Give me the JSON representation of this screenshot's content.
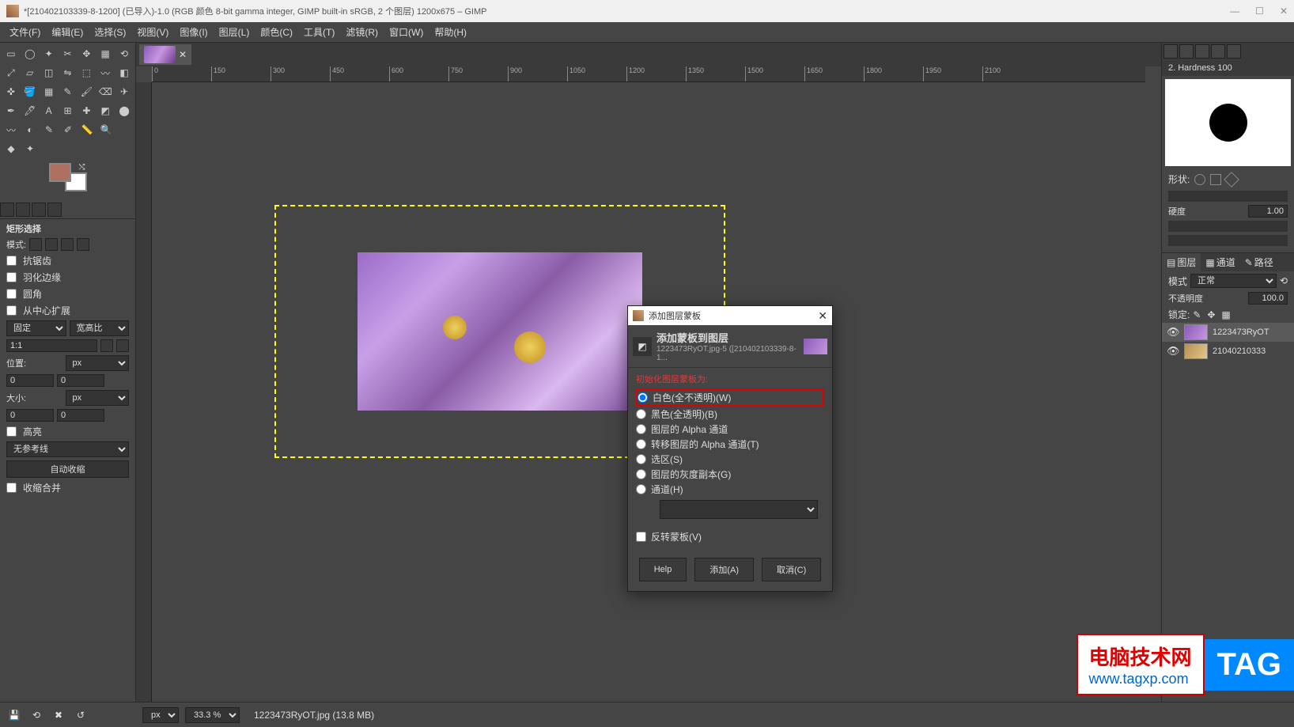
{
  "title": "*[210402103339-8-1200] (已导入)-1.0 (RGB 颜色 8-bit gamma integer, GIMP built-in sRGB, 2 个图层) 1200x675 – GIMP",
  "menu": [
    "文件(F)",
    "编辑(E)",
    "选择(S)",
    "视图(V)",
    "图像(I)",
    "图层(L)",
    "颜色(C)",
    "工具(T)",
    "滤镜(R)",
    "窗口(W)",
    "帮助(H)"
  ],
  "ruler_ticks": [
    "0",
    "150",
    "300",
    "450",
    "600",
    "750",
    "900",
    "1050",
    "1200",
    "1350",
    "1500",
    "1650",
    "1800",
    "1950",
    "2100"
  ],
  "tool_options": {
    "title": "矩形选择",
    "mode_label": "模式:",
    "antialias": "抗锯齿",
    "feather": "羽化边缘",
    "rounded": "圆角",
    "expand": "从中心扩展",
    "fixed": "固定",
    "aspect": "宽高比",
    "ratio": "1:1",
    "position": "位置:",
    "unit_px": "px",
    "pos_x": "0",
    "pos_y": "0",
    "size_label": "大小:",
    "size_w": "0",
    "size_h": "0",
    "highlight": "高亮",
    "guides": "无参考线",
    "autoshrink": "自动收缩",
    "shrinkmerged": "收缩合并"
  },
  "dialog": {
    "window_title": "添加图层蒙板",
    "header_title": "添加蒙板到图层",
    "header_sub": "1223473RyOT.jpg-5 ([210402103339-8-1...",
    "section": "初始化图层蒙板为:",
    "opts": [
      "白色(全不透明)(W)",
      "黑色(全透明)(B)",
      "图层的 Alpha 通道",
      "转移图层的 Alpha 通道(T)",
      "选区(S)",
      "图层的灰度副本(G)",
      "通道(H)"
    ],
    "invert": "反转蒙板(V)",
    "help": "Help",
    "add": "添加(A)",
    "cancel": "取消(C)"
  },
  "brush": {
    "name": "2. Hardness 100",
    "shape_label": "形状:",
    "hardness_label": "硬度",
    "hardness_val": "1.00"
  },
  "layers": {
    "tab_layers": "图层",
    "tab_channels": "通道",
    "tab_paths": "路径",
    "mode_label": "模式",
    "mode_val": "正常",
    "opacity_label": "不透明度",
    "opacity_val": "100.0",
    "lock_label": "锁定:",
    "items": [
      {
        "name": "1223473RyOT"
      },
      {
        "name": "21040210333"
      }
    ]
  },
  "status": {
    "unit": "px",
    "zoom": "33.3 %",
    "info": "1223473RyOT.jpg (13.8 MB)"
  },
  "watermark": {
    "l1": "电脑技术网",
    "l2": "www.tagxp.com",
    "tag": "TAG"
  }
}
